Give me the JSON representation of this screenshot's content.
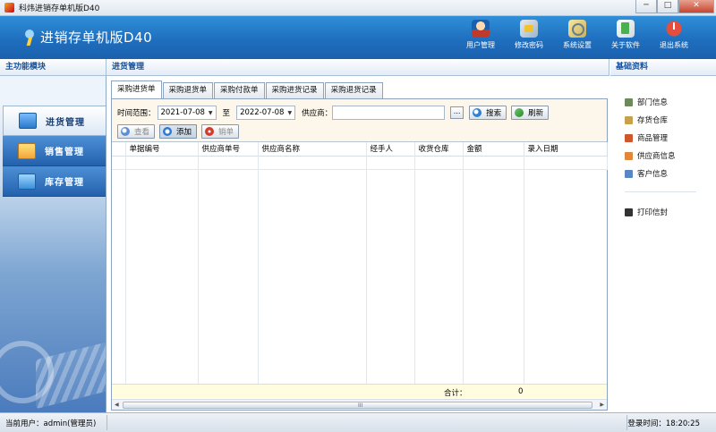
{
  "window": {
    "title": "科炜进销存单机版D40",
    "minimize": "─",
    "maximize": "□",
    "close": "✕"
  },
  "header": {
    "app_title": "进销存单机版D40",
    "toolbar": [
      {
        "label": "用户管理",
        "icon": "user-icon"
      },
      {
        "label": "修改密码",
        "icon": "key-icon"
      },
      {
        "label": "系统设置",
        "icon": "settings-icon"
      },
      {
        "label": "关于软件",
        "icon": "about-icon"
      },
      {
        "label": "退出系统",
        "icon": "power-icon"
      }
    ]
  },
  "sections": {
    "left": "主功能模块",
    "main": "进货管理",
    "right": "基础资料"
  },
  "nav": [
    {
      "label": "进货管理",
      "active": true,
      "icon": "purchase-cart-icon"
    },
    {
      "label": "销售管理",
      "active": false,
      "icon": "sales-icon"
    },
    {
      "label": "库存管理",
      "active": false,
      "icon": "inventory-icon"
    }
  ],
  "tabs": [
    {
      "label": "采购进货单",
      "active": true
    },
    {
      "label": "采购退货单",
      "active": false
    },
    {
      "label": "采购付款单",
      "active": false
    },
    {
      "label": "采购进货记录",
      "active": false
    },
    {
      "label": "采购退货记录",
      "active": false
    }
  ],
  "filter": {
    "range_label": "时间范围：",
    "date_from": "2021-07-08",
    "to_label": "至",
    "date_to": "2022-07-08",
    "supplier_label": "供应商：",
    "supplier_value": "",
    "browse_label": "...",
    "search_label": "搜索",
    "refresh_label": "刷新"
  },
  "actions": {
    "view": "查看",
    "add": "添加",
    "cancel": "销单"
  },
  "grid": {
    "columns": [
      "单据编号",
      "供应商单号",
      "供应商名称",
      "经手人",
      "收货仓库",
      "金额",
      "录入日期"
    ],
    "rows": [],
    "footer": {
      "sum_label": "合计：",
      "sum_value": "0"
    },
    "scroll_grip": "III"
  },
  "right_panel": {
    "items": [
      {
        "label": "部门信息",
        "icon": "department-icon"
      },
      {
        "label": "存货仓库",
        "icon": "warehouse-icon"
      },
      {
        "label": "商品管理",
        "icon": "goods-icon"
      },
      {
        "label": "供应商信息",
        "icon": "supplier-icon"
      },
      {
        "label": "客户信息",
        "icon": "customer-icon"
      }
    ],
    "print": {
      "label": "打印信封",
      "icon": "print-icon"
    }
  },
  "status": {
    "user": "当前用户：admin(管理员)",
    "login_time": "登录时间：18:20:25"
  }
}
